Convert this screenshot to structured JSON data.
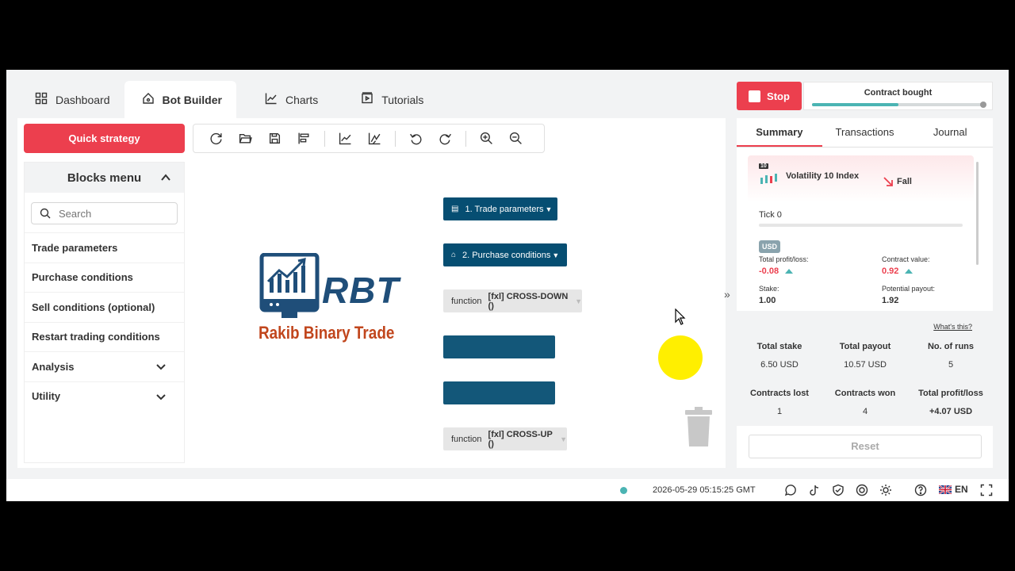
{
  "tabs": [
    {
      "label": "Dashboard",
      "icon": "dashboard-icon"
    },
    {
      "label": "Bot Builder",
      "icon": "bot-icon"
    },
    {
      "label": "Charts",
      "icon": "chart-icon"
    },
    {
      "label": "Tutorials",
      "icon": "tutorials-icon"
    }
  ],
  "workspace": {
    "quick_strategy": "Quick strategy",
    "blocks_menu": {
      "title": "Blocks menu",
      "search_placeholder": "Search",
      "items": [
        "Trade parameters",
        "Purchase conditions",
        "Sell conditions (optional)",
        "Restart trading conditions",
        "Analysis",
        "Utility"
      ]
    },
    "logo": {
      "brand": "RBT",
      "name": "Rakib Binary Trade"
    },
    "blocks": {
      "trade_params": "1. Trade parameters",
      "purchase_conditions": "2. Purchase conditions",
      "func_down_prefix": "function",
      "func_down_name": "[fxl] CROSS-DOWN ()",
      "func_up_prefix": "function",
      "func_up_name": "[fxl] CROSS-UP ()"
    }
  },
  "run_panel": {
    "stop_label": "Stop",
    "contract_status": "Contract bought",
    "progress": 0.5,
    "tabs": [
      "Summary",
      "Transactions",
      "Journal"
    ],
    "contract": {
      "badge": "10",
      "symbol": "Volatility 10 Index",
      "direction": "Fall",
      "tick": "Tick 0",
      "currency": "USD",
      "total_pl_label": "Total profit/loss:",
      "total_pl": "-0.08",
      "contract_value_label": "Contract value:",
      "contract_value": "0.92",
      "stake_label": "Stake:",
      "stake": "1.00",
      "payout_label": "Potential payout:",
      "payout": "1.92"
    },
    "whats_this": "What's this?",
    "stats": {
      "total_stake_label": "Total stake",
      "total_stake": "6.50 USD",
      "total_payout_label": "Total payout",
      "total_payout": "10.57 USD",
      "runs_label": "No. of runs",
      "runs": "5",
      "lost_label": "Contracts lost",
      "lost": "1",
      "won_label": "Contracts won",
      "won": "4",
      "pl_label": "Total profit/loss",
      "pl": "+4.07 USD"
    },
    "reset_label": "Reset"
  },
  "footer": {
    "datetime": "2026-05-29 05:15:25 GMT",
    "language": "EN"
  },
  "colors": {
    "accent": "#ec3f4e",
    "block_dark": "#064e72",
    "profit": "#4bb4b3"
  }
}
